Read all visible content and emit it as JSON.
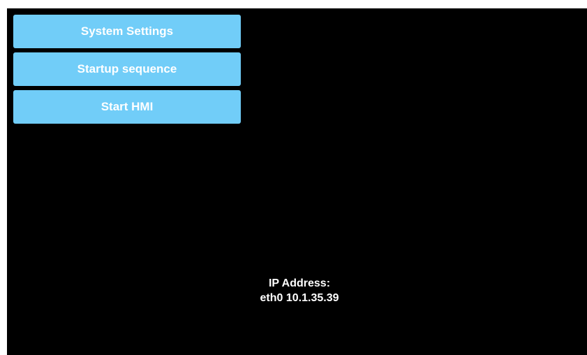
{
  "menu": {
    "items": [
      {
        "label": "System Settings"
      },
      {
        "label": "Startup sequence"
      },
      {
        "label": "Start HMI"
      }
    ]
  },
  "network": {
    "heading": "IP Address:",
    "interface_line": "eth0 10.1.35.39"
  },
  "colors": {
    "background": "#000000",
    "button": "#71cdf8",
    "text": "#ffffff"
  }
}
